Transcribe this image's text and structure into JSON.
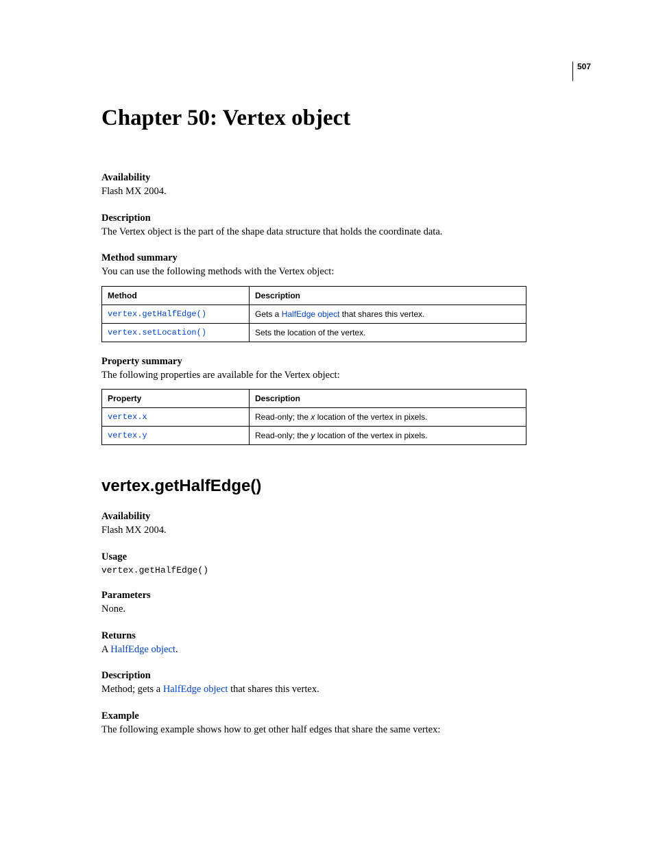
{
  "page_number": "507",
  "chapter_title": "Chapter 50: Vertex object",
  "top": {
    "availability_label": "Availability",
    "availability_text": "Flash MX 2004.",
    "description_label": "Description",
    "description_text": "The Vertex object is the part of the shape data structure that holds the coordinate data.",
    "method_summary_label": "Method summary",
    "method_summary_text": "You can use the following methods with the Vertex object:",
    "method_table": {
      "header_method": "Method",
      "header_description": "Description",
      "rows": [
        {
          "method": "vertex.getHalfEdge()",
          "desc_pre": "Gets a ",
          "desc_link": "HalfEdge object",
          "desc_post": " that shares this vertex."
        },
        {
          "method": "vertex.setLocation()",
          "desc_pre": "Sets the location of the vertex.",
          "desc_link": "",
          "desc_post": ""
        }
      ]
    },
    "property_summary_label": "Property summary",
    "property_summary_text": "The following properties are available for the Vertex object:",
    "property_table": {
      "header_property": "Property",
      "header_description": "Description",
      "rows": [
        {
          "property": "vertex.x",
          "desc_pre": "Read-only; the ",
          "desc_ital": "x",
          "desc_post": " location of the vertex in pixels."
        },
        {
          "property": "vertex.y",
          "desc_pre": "Read-only; the ",
          "desc_ital": "y",
          "desc_post": " location of the vertex in pixels."
        }
      ]
    }
  },
  "section": {
    "title": "vertex.getHalfEdge()",
    "availability_label": "Availability",
    "availability_text": "Flash MX 2004.",
    "usage_label": "Usage",
    "usage_code": "vertex.getHalfEdge()",
    "parameters_label": "Parameters",
    "parameters_text": "None.",
    "returns_label": "Returns",
    "returns_pre": "A ",
    "returns_link": "HalfEdge object",
    "returns_post": ".",
    "description_label": "Description",
    "description_pre": "Method; gets a ",
    "description_link": "HalfEdge object",
    "description_post": " that shares this vertex.",
    "example_label": "Example",
    "example_text": "The following example shows how to get other half edges that share the same vertex:"
  }
}
